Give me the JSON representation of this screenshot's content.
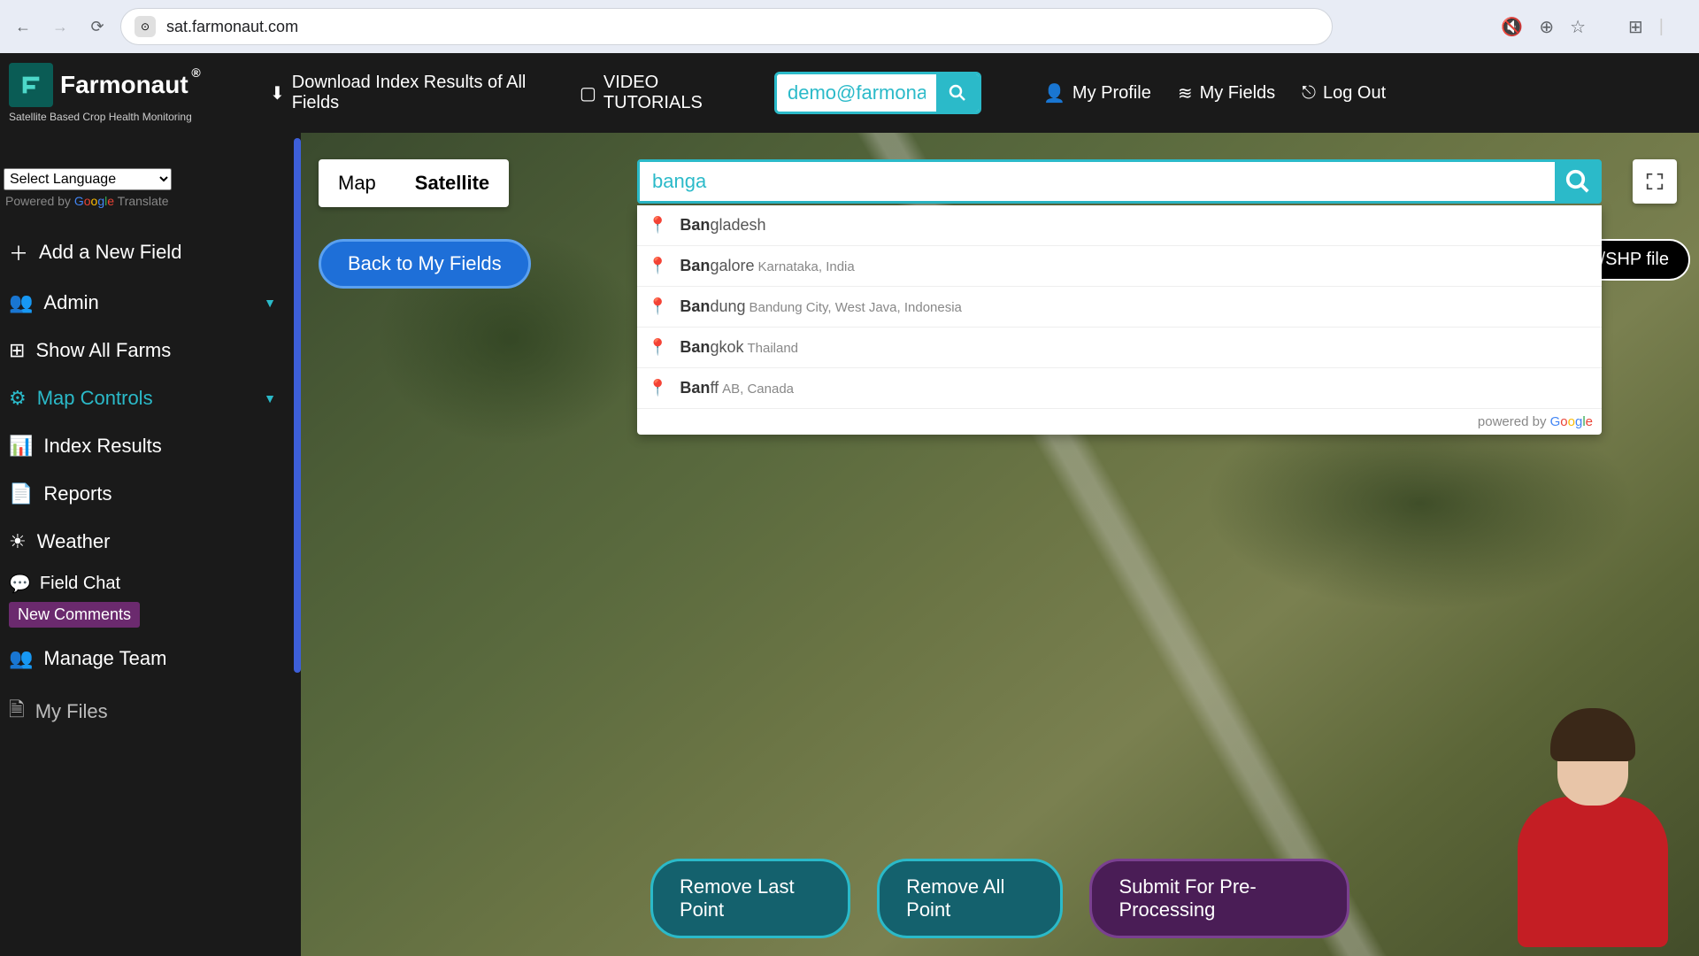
{
  "browser": {
    "url": "sat.farmonaut.com"
  },
  "logo": {
    "name": "Farmonaut",
    "reg": "®",
    "tagline": "Satellite Based Crop Health Monitoring"
  },
  "header": {
    "download": "Download Index Results of All Fields",
    "video": "VIDEO TUTORIALS",
    "email_value": "demo@farmona",
    "profile": "My Profile",
    "fields": "My Fields",
    "logout": "Log Out"
  },
  "sidebar": {
    "lang_placeholder": "Select Language",
    "powered": "Powered by ",
    "translate": " Translate",
    "items": [
      {
        "icon": "+",
        "label": "Add a New Field"
      },
      {
        "icon": "users",
        "label": "Admin",
        "chev": true
      },
      {
        "icon": "grid",
        "label": "Show All Farms"
      },
      {
        "icon": "gear",
        "label": "Map Controls",
        "chev": true,
        "active": true
      },
      {
        "icon": "chart",
        "label": "Index Results"
      },
      {
        "icon": "doc",
        "label": "Reports"
      },
      {
        "icon": "sun",
        "label": "Weather"
      }
    ],
    "field_chat": "Field Chat",
    "new_comments": "New Comments",
    "manage_team": "Manage Team",
    "my_files": "My Files"
  },
  "map": {
    "tabs": {
      "map": "Map",
      "satellite": "Satellite"
    },
    "back": "Back to My Fields",
    "kml": "KML/SHP file",
    "search_value": "banga",
    "suggestions": [
      {
        "bold": "Ban",
        "rest": "gladesh",
        "sub": ""
      },
      {
        "bold": "Ban",
        "rest": "galore",
        "sub": "Karnataka, India"
      },
      {
        "bold": "Ban",
        "rest": "dung",
        "sub": "Bandung City, West Java, Indonesia"
      },
      {
        "bold": "Ban",
        "rest": "gkok",
        "sub": "Thailand"
      },
      {
        "bold": "Ban",
        "rest": "ff",
        "sub": "AB, Canada"
      }
    ],
    "powered_google": "powered by ",
    "btns": {
      "remove_last": "Remove Last Point",
      "remove_all": "Remove All Point",
      "submit": "Submit For Pre-Processing"
    }
  }
}
